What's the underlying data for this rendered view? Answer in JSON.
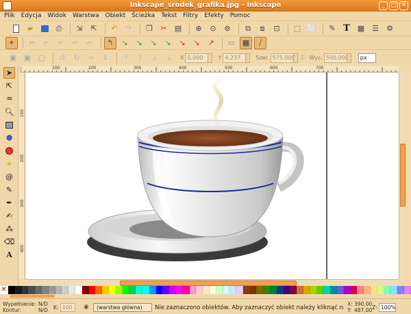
{
  "window": {
    "title": "Inkscape_srodek_grafika.jpg - Inkscape"
  },
  "menu": [
    "Plik",
    "Edycja",
    "Widok",
    "Warstwa",
    "Obiekt",
    "Ścieżka",
    "Tekst",
    "Filtry",
    "Efekty",
    "Pomoc"
  ],
  "toolbar_main": [
    "new-document-icon",
    "open-icon",
    "save-icon",
    "print-icon",
    "import-icon",
    "export-icon",
    "undo-icon",
    "redo-icon",
    "copy-icon",
    "cut-icon",
    "paste-icon",
    "zoom-selection-icon",
    "zoom-drawing-icon",
    "zoom-page-icon",
    "duplicate-icon",
    "clone-icon",
    "unlink-clone-icon",
    "group-icon",
    "ungroup-icon",
    "fill-stroke-icon",
    "text-font-icon",
    "xml-editor-icon",
    "align-icon",
    "preferences-icon"
  ],
  "selector_bar": {
    "x_label": "X",
    "x_value": "0,000",
    "y_label": "Y",
    "y_value": "4,237",
    "w_label": "Szer.",
    "w_value": "575,000",
    "h_label": "Wys.",
    "h_value": "500,000",
    "units": "px"
  },
  "rulers": {
    "top_labels": [
      "100",
      "200",
      "300",
      "400",
      "500",
      "600",
      "700"
    ],
    "left_labels": [
      "100",
      "200",
      "300",
      "400"
    ]
  },
  "palette": [
    "#000000",
    "#1a1a1a",
    "#333333",
    "#4d4d4d",
    "#666666",
    "#808080",
    "#999999",
    "#b3b3b3",
    "#cccccc",
    "#e6e6e6",
    "#ffffff",
    "#800000",
    "#ff0000",
    "#ff6600",
    "#ffcc00",
    "#ffff00",
    "#99ff00",
    "#00ff00",
    "#00cc66",
    "#00ffcc",
    "#00ffff",
    "#0099ff",
    "#0000ff",
    "#6600ff",
    "#cc00ff",
    "#ff00ff",
    "#ff0099",
    "#ff99cc",
    "#ffcccc",
    "#ffe6cc",
    "#ffffcc",
    "#ccffcc",
    "#ccffff",
    "#cce6ff",
    "#e6ccff",
    "#804000",
    "#803300",
    "#806600",
    "#408000",
    "#008040",
    "#004080",
    "#400080",
    "#800040",
    "#c87137",
    "#d4aa00",
    "#aad400",
    "#55d400",
    "#00d4aa",
    "#0088aa",
    "#5f5fd3",
    "#aa00d4",
    "#d40055",
    "#ff8080",
    "#ffb380",
    "#ffe680",
    "#d5ff80",
    "#80ffb3",
    "#80e5ff",
    "#8080ff",
    "#e580ff"
  ],
  "status": {
    "fill_label": "Wypełnienie:",
    "fill_value": "N/D",
    "stroke_label": "Kontur:",
    "stroke_value": "N/D",
    "k_label": "K:",
    "k_value": "100",
    "layer": "(warstwa główna)",
    "message": "Nie zaznaczono obiektów. Aby zaznaczyć obiekt należy kliknąć na nim,",
    "x_label": "X:",
    "x_value": "390,00",
    "y_label": "Y:",
    "y_value": "487,00",
    "z_label": "Z:",
    "zoom": "100%"
  }
}
